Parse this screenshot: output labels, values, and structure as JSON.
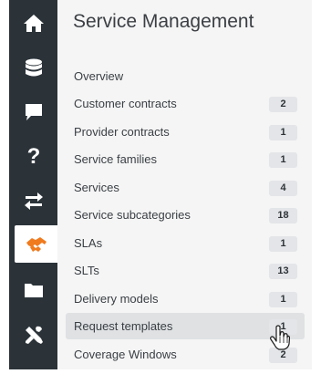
{
  "sidebar": {
    "icons": [
      {
        "name": "home-icon",
        "active": false
      },
      {
        "name": "database-icon",
        "active": false
      },
      {
        "name": "chat-icon",
        "active": false
      },
      {
        "name": "help-icon",
        "active": false
      },
      {
        "name": "transfer-icon",
        "active": false
      },
      {
        "name": "handshake-icon",
        "active": true,
        "color": "#f07b1e"
      },
      {
        "name": "folder-icon",
        "active": false
      },
      {
        "name": "tools-icon",
        "active": false
      }
    ]
  },
  "panel": {
    "title": "Service Management",
    "items": [
      {
        "label": "Overview",
        "count": null
      },
      {
        "label": "Customer contracts",
        "count": "2"
      },
      {
        "label": "Provider contracts",
        "count": "1"
      },
      {
        "label": "Service families",
        "count": "1"
      },
      {
        "label": "Services",
        "count": "4"
      },
      {
        "label": "Service subcategories",
        "count": "18"
      },
      {
        "label": "SLAs",
        "count": "1"
      },
      {
        "label": "SLTs",
        "count": "13"
      },
      {
        "label": "Delivery models",
        "count": "1"
      },
      {
        "label": "Request templates",
        "count": "1",
        "hovered": true
      },
      {
        "label": "Coverage Windows",
        "count": "2"
      }
    ]
  },
  "colors": {
    "rail": "#2b3339",
    "accent": "#f07b1e",
    "panel_bg": "#f5f5f5",
    "hover_bg": "#dfe1e3",
    "badge_bg": "#e3e5e8"
  }
}
